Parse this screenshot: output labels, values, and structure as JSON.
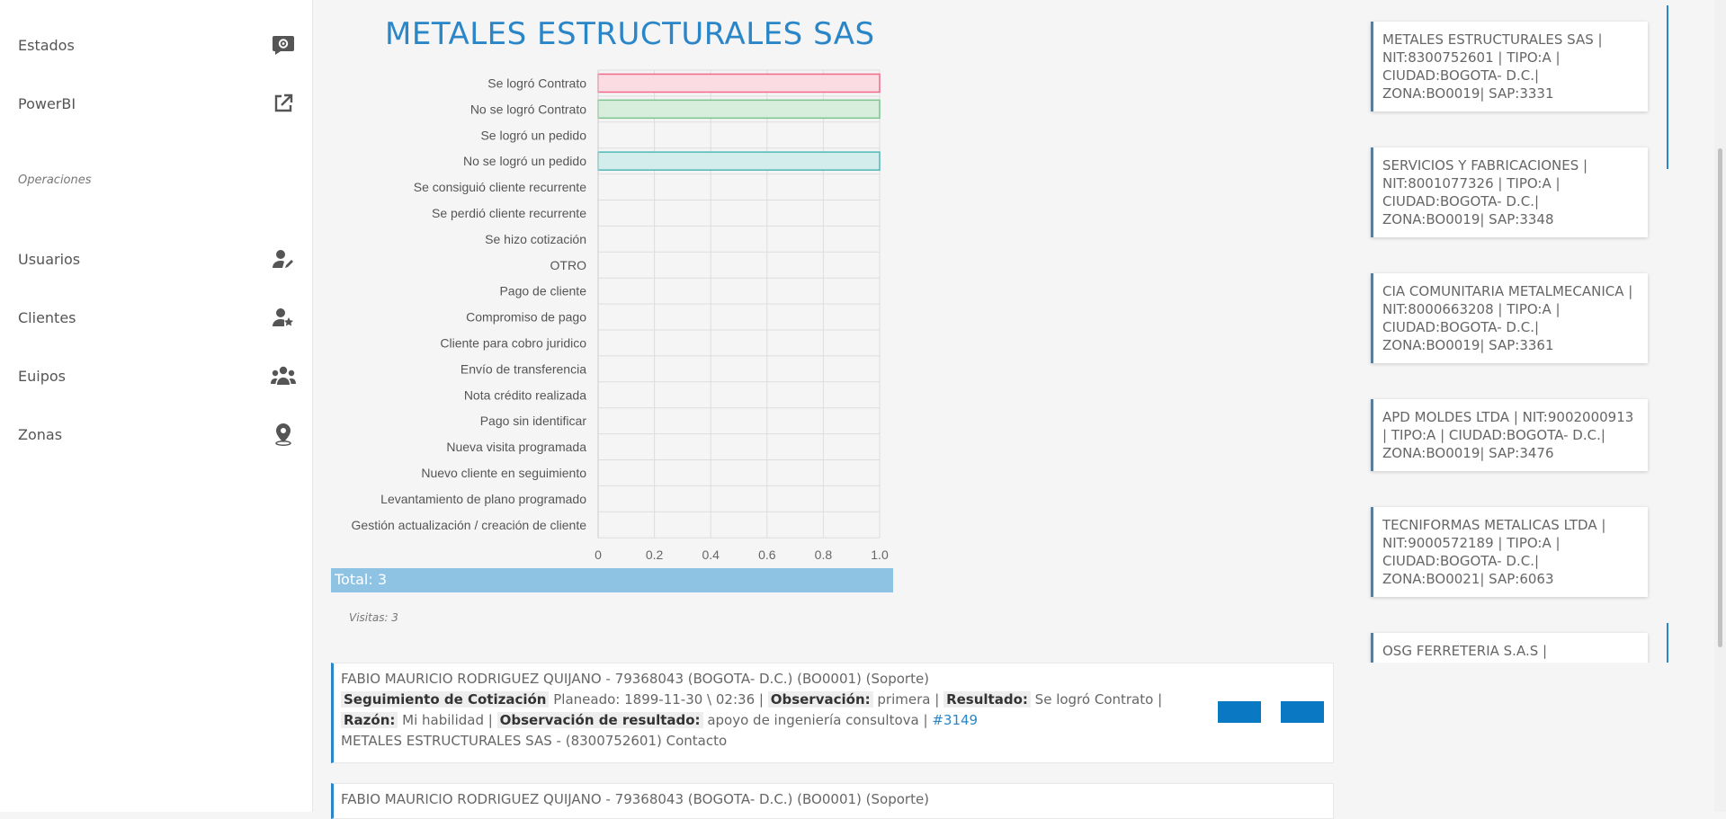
{
  "sidebar": {
    "items_top": [
      {
        "label": "Estados",
        "icon": "chat-gear-icon"
      },
      {
        "label": "PowerBI",
        "icon": "external-link-icon"
      }
    ],
    "section": "Operaciones",
    "items_ops": [
      {
        "label": "Usuarios",
        "icon": "user-edit-icon"
      },
      {
        "label": "Clientes",
        "icon": "user-star-icon"
      },
      {
        "label": "Euipos",
        "icon": "users-group-icon"
      },
      {
        "label": "Zonas",
        "icon": "map-pin-icon"
      }
    ]
  },
  "main": {
    "company_title": "METALES ESTRUCTURALES SAS",
    "total": "Total: 3",
    "visitas": "Visitas: 3"
  },
  "chart_data": {
    "type": "bar",
    "orientation": "horizontal",
    "categories": [
      "Se logró Contrato",
      "No se logró Contrato",
      "Se logró un pedido",
      "No se logró un pedido",
      "Se consiguió cliente recurrente",
      "Se perdió cliente recurrente",
      "Se hizo cotización",
      "OTRO",
      "Pago de cliente",
      "Compromiso de pago",
      "Cliente para cobro juridico",
      "Envío de transferencia",
      "Nota crédito realizada",
      "Pago sin identificar",
      "Nueva visita programada",
      "Nuevo cliente en seguimiento",
      "Levantamiento de plano programado",
      "Gestión actualización / creación de cliente"
    ],
    "values": [
      1,
      1,
      0,
      1,
      0,
      0,
      0,
      0,
      0,
      0,
      0,
      0,
      0,
      0,
      0,
      0,
      0,
      0
    ],
    "bar_fill_colors": [
      "#fbdce3",
      "#d8eedd",
      "#ffffff",
      "#d3ecec"
    ],
    "bar_stroke_colors": [
      "#f06a8a",
      "#7cc38e",
      "#cccccc",
      "#4fb8b8"
    ],
    "xlim": [
      0,
      1.0
    ],
    "xticks": [
      "0",
      "0.2",
      "0.4",
      "0.6",
      "0.8",
      "1.0"
    ],
    "grid": true,
    "title": "",
    "xlabel": "",
    "ylabel": ""
  },
  "visits": [
    {
      "header": "FABIO MAURICIO RODRIGUEZ QUIJANO - 79368043 (BOGOTA- D.C.) (BO0001) (Soporte)",
      "tipo": "Seguimiento de Cotización",
      "planeado": "Planeado: 1899-11-30 \\ 02:36 |",
      "obs_label": "Observación:",
      "obs_value": "primera |",
      "res_label": "Resultado:",
      "res_value": "Se logró Contrato |",
      "razon_label": "Razón:",
      "razon_value": "Mi habilidad |",
      "obsres_label": "Observación de resultado:",
      "obsres_value": "apoyo de ingeniería consultova |",
      "id_link": "#3149",
      "client": "METALES ESTRUCTURALES SAS - (8300752601) Contacto"
    },
    {
      "header": "FABIO MAURICIO RODRIGUEZ QUIJANO - 79368043 (BOGOTA- D.C.) (BO0001) (Soporte)"
    }
  ],
  "clients": [
    "METALES ESTRUCTURALES SAS | NIT:8300752601 | TIPO:A | CIUDAD:BOGOTA- D.C.| ZONA:BO0019| SAP:3331",
    "SERVICIOS Y FABRICACIONES | NIT:8001077326 | TIPO:A | CIUDAD:BOGOTA- D.C.| ZONA:BO0019| SAP:3348",
    "CIA COMUNITARIA METALMECANICA | NIT:8000663208 | TIPO:A | CIUDAD:BOGOTA- D.C.| ZONA:BO0019| SAP:3361",
    "APD MOLDES LTDA | NIT:9002000913 | TIPO:A | CIUDAD:BOGOTA- D.C.| ZONA:BO0019| SAP:3476",
    "TECNIFORMAS METALICAS LTDA | NIT:9000572189 | TIPO:A | CIUDAD:BOGOTA- D.C.| ZONA:BO0021| SAP:6063",
    "OSG FERRETERIA S.A.S |"
  ]
}
